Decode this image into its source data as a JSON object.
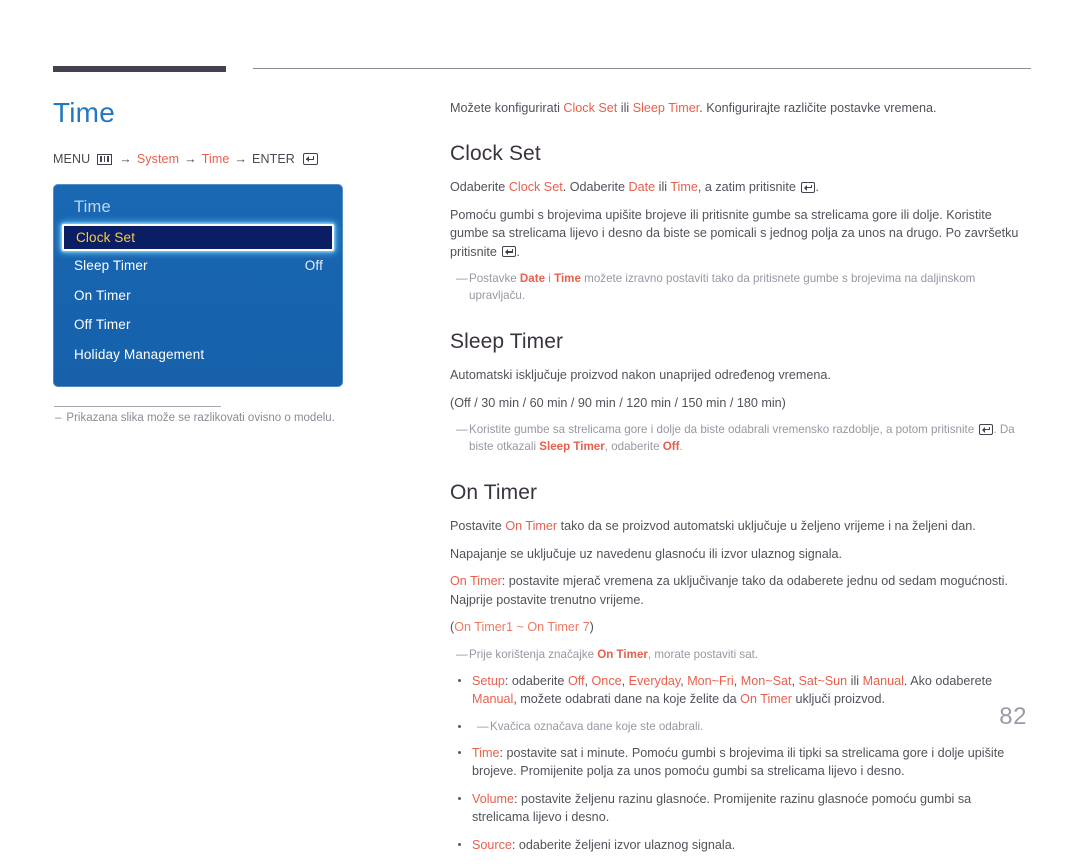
{
  "page": {
    "number": "82"
  },
  "left": {
    "title": "Time",
    "breadcrumb": {
      "menu_label": "MENU",
      "menu_icon": "menu-bars-icon",
      "arrow": "→",
      "item1": "System",
      "item2": "Time",
      "enter_label": "ENTER",
      "enter_icon": "enter-return-icon"
    },
    "osd": {
      "title": "Time",
      "items": [
        {
          "label": "Clock Set",
          "value": "",
          "selected": true
        },
        {
          "label": "Sleep Timer",
          "value": "Off",
          "selected": false
        },
        {
          "label": "On Timer",
          "value": "",
          "selected": false
        },
        {
          "label": "Off Timer",
          "value": "",
          "selected": false
        },
        {
          "label": "Holiday Management",
          "value": "",
          "selected": false
        }
      ]
    },
    "note": {
      "dash": "–",
      "text": "Prikazana slika može se razlikovati ovisno o modelu."
    }
  },
  "right": {
    "lead": {
      "p1": "Možete konfigurirati ",
      "t1": "Clock Set",
      "p2": " ili ",
      "t2": "Sleep Timer",
      "p3": ". Konfigurirajte različite postavke vremena."
    },
    "clock_set": {
      "heading": "Clock Set",
      "p1a": "Odaberite ",
      "p1b": "Clock Set",
      "p1c": ". Odaberite ",
      "p1d": "Date",
      "p1e": " ili ",
      "p1f": "Time",
      "p1g": ", a zatim pritisnite ",
      "p1h": ".",
      "p2": "Pomoću gumbi s brojevima upišite brojeve ili pritisnite gumbe sa strelicama gore ili dolje. Koristite gumbe sa strelicama lijevo i desno da biste se pomicali s jednog polja za unos na drugo. Po završetku pritisnite ",
      "p2b": ".",
      "note": {
        "macron": "―",
        "a": "Postavke ",
        "b": "Date",
        "c": " i ",
        "d": "Time",
        "e": " možete izravno postaviti tako da pritisnete gumbe s brojevima na daljinskom upravljaču."
      }
    },
    "sleep_timer": {
      "heading": "Sleep Timer",
      "p1": "Automatski isključuje proizvod nakon unaprijed određenog vremena.",
      "options_open": "(",
      "options": [
        "Off",
        "30 min",
        "60 min",
        "90 min",
        "120 min",
        "150 min",
        "180 min"
      ],
      "options_sep": " / ",
      "options_close": ")",
      "note": {
        "macron": "―",
        "a": "Koristite gumbe sa strelicama gore i dolje da biste odabrali vremensko razdoblje, a potom pritisnite ",
        "b": ". Da biste otkazali ",
        "c": "Sleep Timer",
        "d": ", odaberite ",
        "e": "Off",
        "f": "."
      }
    },
    "on_timer": {
      "heading": "On Timer",
      "p1a": "Postavite ",
      "p1b": "On Timer",
      "p1c": " tako da se proizvod automatski uključuje u željeno vrijeme i na željeni dan.",
      "p2": "Napajanje se uključuje uz navedenu glasnoću ili izvor ulaznog signala.",
      "p3a": "On Timer",
      "p3b": ": postavite mjerač vremena za uključivanje tako da odaberete jednu od sedam mogućnosti. Najprije postavite trenutno vrijeme.",
      "p4": "(On Timer1 ~ On Timer 7)",
      "p4a": "On Timer1 ~ On Timer 7",
      "note1": {
        "macron": "―",
        "a": "Prije korištenja značajke ",
        "b": "On Timer",
        "c": ", morate postaviti sat."
      },
      "bullets": {
        "setup": {
          "label": "Setup",
          "a": ": odaberite ",
          "opts": [
            "Off",
            "Once",
            "Everyday",
            "Mon~Fri",
            "Mon~Sat",
            "Sat~Sun"
          ],
          "b": " ili ",
          "c": "Manual",
          "d": ". Ako odaberete ",
          "e": "Manual",
          "f": ", možete odabrati dane na koje želite da ",
          "g": "On Timer",
          "h": " uključi proizvod."
        },
        "setup_note": {
          "macron": "―",
          "text": "Kvačica označava dane koje ste odabrali."
        },
        "time": {
          "label": "Time",
          "text": ": postavite sat i minute. Pomoću gumbi s brojevima ili tipki sa strelicama gore i dolje upišite brojeve. Promijenite polja za unos pomoću gumbi sa strelicama lijevo i desno."
        },
        "volume": {
          "label": "Volume",
          "text": ": postavite željenu razinu glasnoće. Promijenite razinu glasnoće pomoću gumbi sa strelicama lijevo i desno."
        },
        "source": {
          "label": "Source",
          "text": ": odaberite željeni izvor ulaznog signala."
        }
      }
    }
  },
  "colors": {
    "accent_blue": "#2578c0",
    "accent_orange": "#e8604c",
    "panel_blue": "#1763ae",
    "selected_navy": "#0b1d63",
    "selected_text": "#f7cd4a",
    "heading_dark": "#3b3240"
  }
}
